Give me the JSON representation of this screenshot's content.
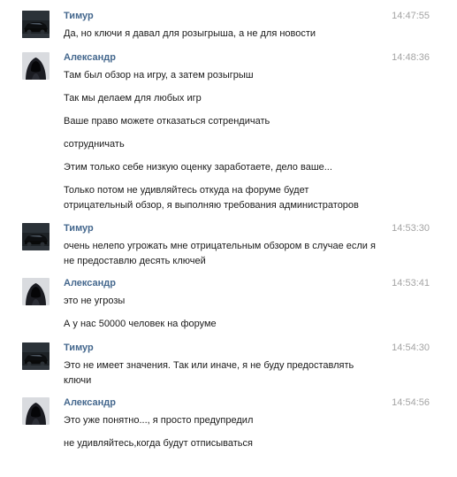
{
  "conversation": {
    "messages": [
      {
        "author": "Тимур",
        "avatar": "car-photo-avatar",
        "time": "14:47:55",
        "paragraphs": [
          [
            "Да, но ключи я давал для розыгрыша, а не для новости"
          ]
        ]
      },
      {
        "author": "Александр",
        "avatar": "hooded-figure-avatar",
        "time": "14:48:36",
        "paragraphs": [
          [
            "Там был обзор на игру, а затем розыгрыш"
          ],
          [
            "Так мы делаем для любых игр"
          ],
          [
            "Ваше право можете отказаться сотрендичать"
          ],
          [
            "сотрудничать"
          ],
          [
            "Этим только себе низкую оценку заработаете, дело ваше..."
          ],
          [
            "Только потом не удивляйтесь откуда на форуме будет",
            "отрицательный обзор, я выполняю требования администраторов"
          ]
        ]
      },
      {
        "author": "Тимур",
        "avatar": "car-photo-avatar",
        "time": "14:53:30",
        "paragraphs": [
          [
            "очень нелепо угрожать мне отрицательным обзором в случае если я",
            "не предоставлю десять ключей"
          ]
        ]
      },
      {
        "author": "Александр",
        "avatar": "hooded-figure-avatar",
        "time": "14:53:41",
        "paragraphs": [
          [
            "это не угрозы"
          ],
          [
            "А у нас 50000 человек на форуме"
          ]
        ]
      },
      {
        "author": "Тимур",
        "avatar": "car-photo-avatar",
        "time": "14:54:30",
        "paragraphs": [
          [
            "Это не имеет значения. Так или иначе, я не буду предоставлять",
            "ключи"
          ]
        ]
      },
      {
        "author": "Александр",
        "avatar": "hooded-figure-avatar",
        "time": "14:54:56",
        "paragraphs": [
          [
            "Это уже понятно..., я просто предупредил"
          ],
          [
            "не удивляйтесь,когда будут отписываться"
          ]
        ]
      }
    ]
  }
}
